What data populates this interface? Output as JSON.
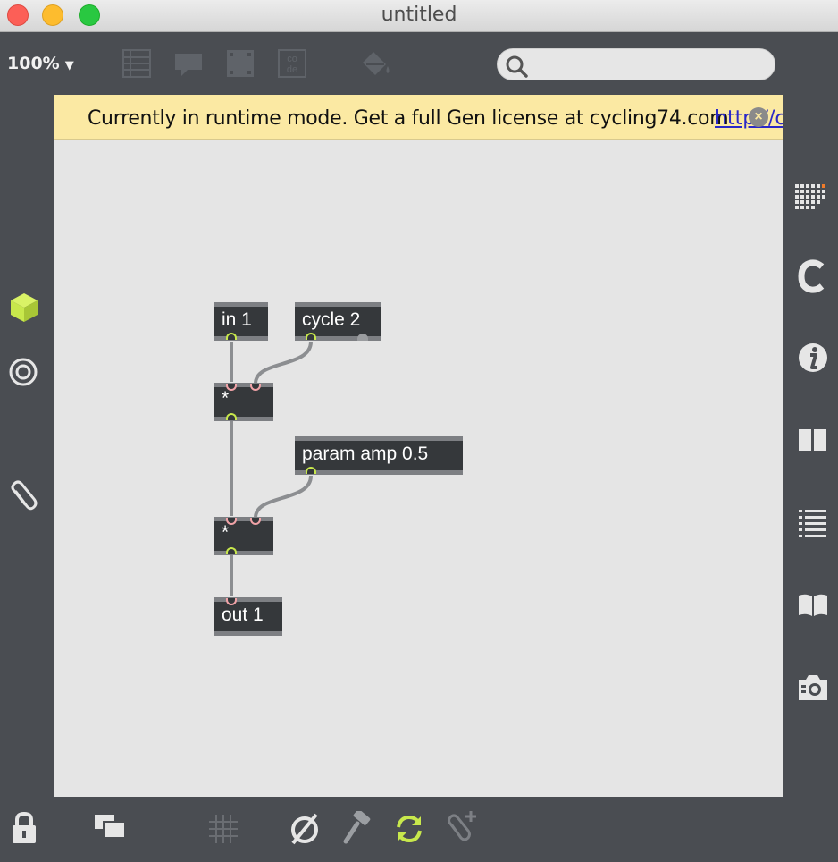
{
  "window": {
    "title": "untitled"
  },
  "toolbar": {
    "zoom": "100%",
    "search_placeholder": "",
    "icons": [
      "presentation-icon",
      "comment-icon",
      "frame-icon",
      "code-icon",
      "paint-bucket-icon"
    ]
  },
  "banner": {
    "message": "Currently in runtime mode. Get a full Gen license at cycling74.com",
    "link": "http://c"
  },
  "patch": {
    "objects": [
      {
        "id": "in1",
        "label": "in 1"
      },
      {
        "id": "cycle",
        "label": "cycle 2"
      },
      {
        "id": "mul1",
        "label": "*"
      },
      {
        "id": "param",
        "label": "param amp 0.5"
      },
      {
        "id": "mul2",
        "label": "*"
      },
      {
        "id": "out1",
        "label": "out 1"
      }
    ]
  },
  "left_rail": [
    "gen-cube-icon",
    "target-icon",
    "paperclip-icon"
  ],
  "right_rail": [
    "grid-icon",
    "c-icon",
    "info-icon",
    "columns-icon",
    "list-icon",
    "book-icon",
    "camera-icon"
  ],
  "bottom_bar": [
    "lock-icon",
    "windows-icon",
    "grid-snap-icon",
    "mute-icon",
    "hammer-icon",
    "refresh-icon",
    "paperclip-add-icon"
  ],
  "colors": {
    "accent_green": "#c8e84c",
    "inlet_color": "#f2a3a8",
    "outlet_color": "#c8e84c",
    "background": "#4a4d52",
    "canvas": "#e5e5e5",
    "banner": "#fbe9a3"
  }
}
